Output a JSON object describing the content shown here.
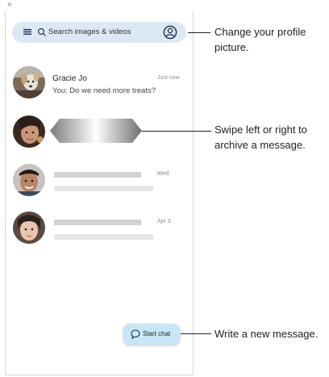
{
  "corner_mark": "»",
  "search": {
    "placeholder": "Search images & videos"
  },
  "conversations": [
    {
      "sender": "Gracie Jo",
      "time": "Just now",
      "preview": "You: Do we need more treats?"
    },
    {
      "sender": "",
      "time": "",
      "preview": ""
    },
    {
      "sender": "",
      "time": "Wed",
      "preview": ""
    },
    {
      "sender": "",
      "time": "Apr 3",
      "preview": ""
    }
  ],
  "start_chat": {
    "label": "Start chat"
  },
  "callouts": {
    "profile": "Change your profile picture.",
    "swipe": "Swipe left or right to archive a message.",
    "new_message": "Write a new message."
  },
  "colors": {
    "search_bar": "#dde8f5",
    "start_chat_button": "#c8e6f5",
    "icon_navy": "#1e2b45"
  },
  "icons": [
    "menu-icon",
    "search-icon",
    "profile-icon",
    "chat-bubble-icon"
  ]
}
